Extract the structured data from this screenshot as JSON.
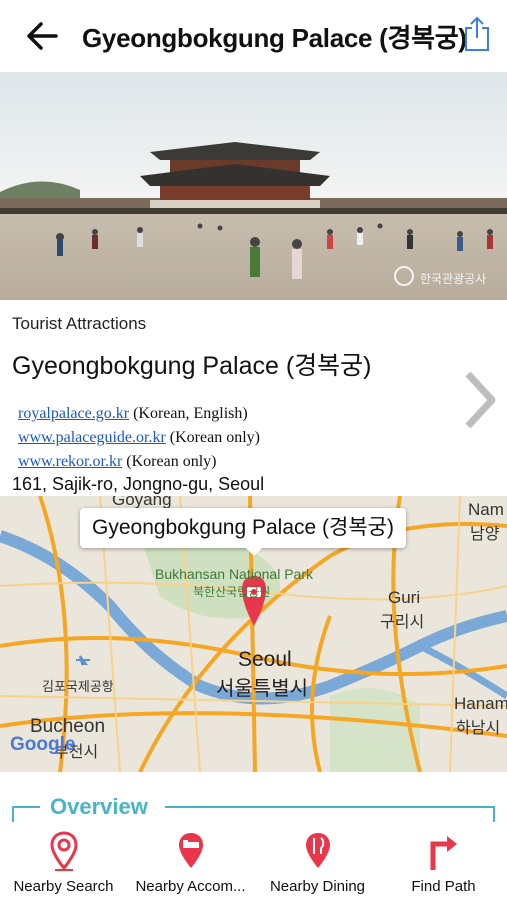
{
  "header": {
    "title": "Gyeongbokgung Palace (경복궁)"
  },
  "photo": {
    "watermark": "한국관광공사"
  },
  "detail": {
    "category": "Tourist Attractions",
    "name": "Gyeongbokgung Palace (경복궁)",
    "links": [
      {
        "url": "royalpalace.go.kr",
        "note": " (Korean, English)"
      },
      {
        "url": "www.palaceguide.or.kr",
        "note": " (Korean only)"
      },
      {
        "url": "www.rekor.or.kr",
        "note": " (Korean only)"
      }
    ],
    "address": "161, Sajik-ro, Jongno-gu, Seoul"
  },
  "map": {
    "callout": "Gyeongbokgung Palace (경복궁)",
    "labels": {
      "goyang": "Goyang",
      "namyangju": "Nam",
      "namyangju_ko": "남양",
      "bukhansan": "Bukhansan National Park",
      "bukhansan_ko": "북한산국립공원",
      "guri": "Guri",
      "guri_ko": "구리시",
      "seoul": "Seoul",
      "seoul_ko": "서울특별시",
      "gimpo_ko": "김포국제공항",
      "hanam": "Hanam",
      "hanam_ko": "하남시",
      "bucheon": "Bucheon",
      "bucheon_ko": "부천시",
      "google": "Google"
    }
  },
  "overview": {
    "label": "Overview"
  },
  "tabs": [
    {
      "label": "Nearby Search",
      "icon": "location-pin-icon"
    },
    {
      "label": "Nearby Accom...",
      "icon": "bed-pin-icon"
    },
    {
      "label": "Nearby Dining",
      "icon": "dining-pin-icon"
    },
    {
      "label": "Find Path",
      "icon": "turn-arrow-icon"
    }
  ],
  "colors": {
    "accent": "#e8364b",
    "overview": "#49b4c8",
    "link": "#1a57c8",
    "road": "#f5a623",
    "river": "#7aa9d8"
  }
}
